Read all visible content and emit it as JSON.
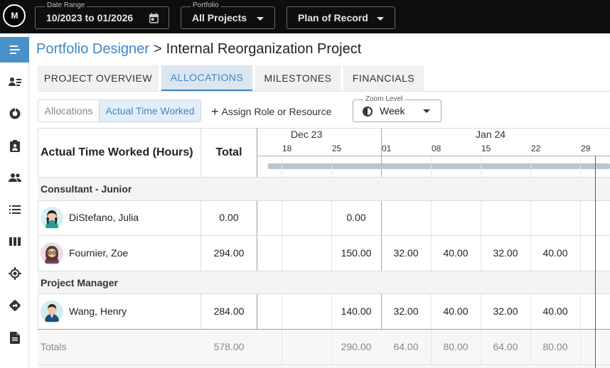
{
  "topbar": {
    "logo_text": "M",
    "date_range": {
      "label": "Date Range",
      "value": "10/2023 to 01/2026"
    },
    "portfolio": {
      "label": "Portfolio",
      "value": "All Projects"
    },
    "plan": {
      "value": "Plan of Record"
    }
  },
  "sidebar": {
    "items": [
      "menu-icon",
      "user-list-icon",
      "donut-chart-icon",
      "clipboard-person-icon",
      "people-icon",
      "list-icon",
      "columns-icon",
      "target-icon",
      "route-icon",
      "document-icon"
    ],
    "active_color": "#4a90c9"
  },
  "breadcrumb": {
    "root": "Portfolio Designer",
    "separator": ">",
    "current": "Internal Reorganization Project"
  },
  "tabs": [
    {
      "label": "PROJECT OVERVIEW",
      "active": false
    },
    {
      "label": "ALLOCATIONS",
      "active": true
    },
    {
      "label": "MILESTONES",
      "active": false
    },
    {
      "label": "FINANCIALS",
      "active": false
    }
  ],
  "toolbar": {
    "toggle_allocations": "Allocations",
    "toggle_actual": "Actual Time Worked",
    "assign_label": "Assign Role or Resource",
    "zoom_label": "Zoom Level",
    "zoom_value": "Week"
  },
  "grid": {
    "header_title": "Actual Time Worked (Hours)",
    "header_total": "Total",
    "months": [
      "Dec 23",
      "Jan 24"
    ],
    "weeks": [
      "18",
      "25",
      "01",
      "08",
      "15",
      "22",
      "29"
    ],
    "groups": [
      {
        "name": "Consultant - Junior",
        "rows": [
          {
            "name": "DiStefano, Julia",
            "total": "0.00",
            "cells": [
              "",
              "0.00",
              "",
              "",
              "",
              "",
              ""
            ]
          }
        ]
      },
      {
        "name": "",
        "rows": [
          {
            "name": "Fournier, Zoe",
            "total": "294.00",
            "cells": [
              "",
              "150.00",
              "32.00",
              "40.00",
              "32.00",
              "40.00",
              ""
            ]
          }
        ]
      },
      {
        "name": "Project Manager",
        "rows": [
          {
            "name": "Wang, Henry",
            "total": "284.00",
            "cells": [
              "",
              "140.00",
              "32.00",
              "40.00",
              "32.00",
              "40.00",
              ""
            ]
          }
        ]
      }
    ],
    "totals": {
      "label": "Totals",
      "total": "578.00",
      "cells": [
        "",
        "290.00",
        "64.00",
        "80.00",
        "64.00",
        "80.00",
        ""
      ]
    }
  },
  "colors": {
    "accent": "#3f86c4",
    "today_line": "#c0392b",
    "topbar": "#0e0e0e"
  }
}
